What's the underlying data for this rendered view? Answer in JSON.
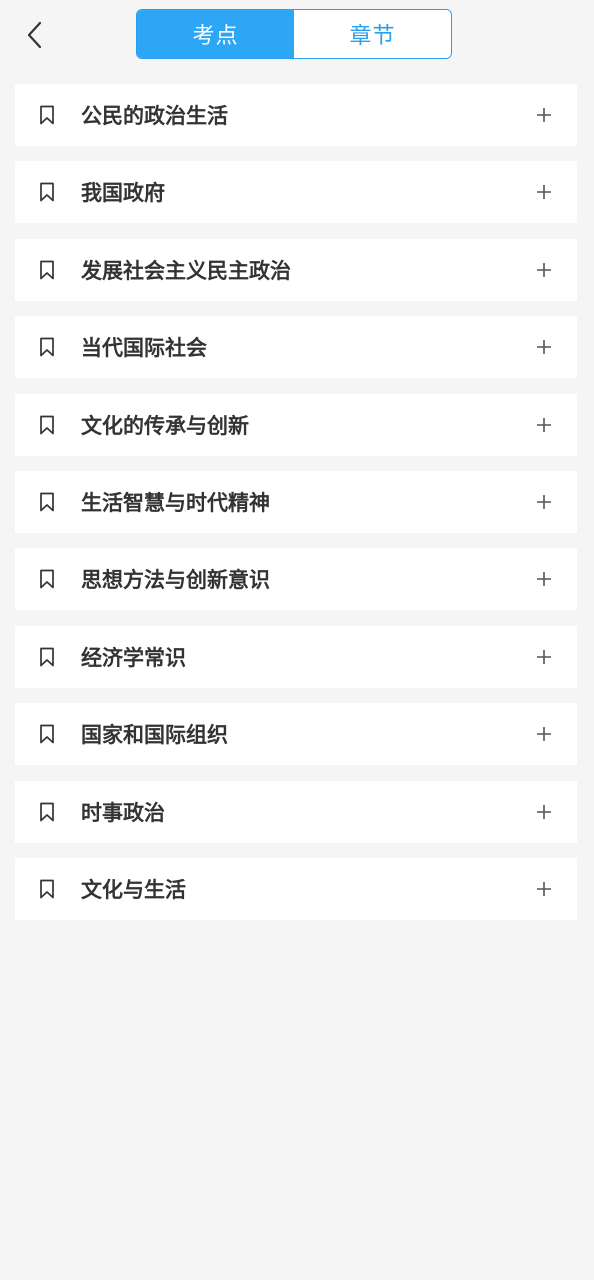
{
  "header": {
    "back_icon": "chevron-left-icon",
    "tabs": [
      {
        "label": "考点",
        "active": true
      },
      {
        "label": "章节",
        "active": false
      }
    ],
    "accent_color": "#2ca6f5"
  },
  "list": {
    "items": [
      {
        "label": "公民的政治生活"
      },
      {
        "label": "我国政府"
      },
      {
        "label": "发展社会主义民主政治"
      },
      {
        "label": "当代国际社会"
      },
      {
        "label": "文化的传承与创新"
      },
      {
        "label": "生活智慧与时代精神"
      },
      {
        "label": "思想方法与创新意识"
      },
      {
        "label": "经济学常识"
      },
      {
        "label": "国家和国际组织"
      },
      {
        "label": "时事政治"
      },
      {
        "label": "文化与生活"
      }
    ],
    "item_icon": "bookmark-icon",
    "expand_icon": "plus-icon"
  }
}
